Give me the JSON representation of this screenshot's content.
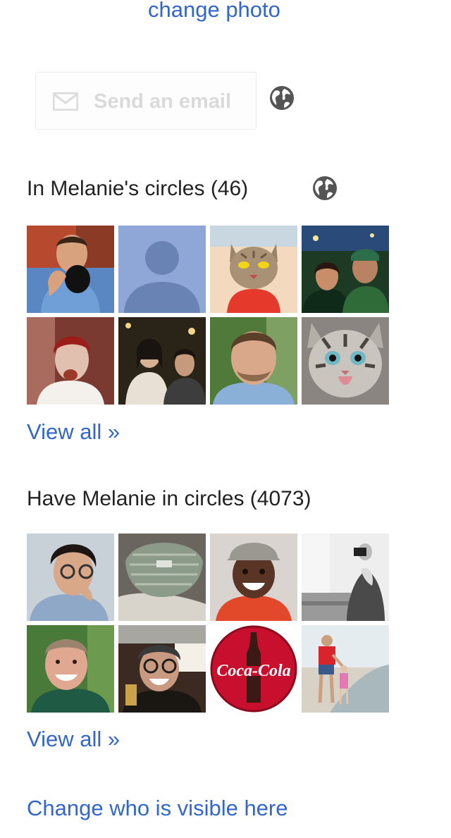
{
  "profile": {
    "change_photo": "change photo"
  },
  "email_button": {
    "label": "Send an email",
    "icon": "envelope-icon"
  },
  "in_circles": {
    "title": "In Melanie's circles (46)",
    "visibility_icon": "globe-icon",
    "view_all": "View all »",
    "people": [
      {
        "name": "person-drinking",
        "kind": "photo"
      },
      {
        "name": "default-silhouette",
        "kind": "placeholder"
      },
      {
        "name": "cartoon-cat",
        "kind": "illustration"
      },
      {
        "name": "couple-at-night",
        "kind": "photo"
      },
      {
        "name": "red-haired-man",
        "kind": "photo"
      },
      {
        "name": "two-friends",
        "kind": "photo"
      },
      {
        "name": "bearded-man",
        "kind": "photo"
      },
      {
        "name": "tabby-kitten",
        "kind": "photo"
      }
    ]
  },
  "have_in_circles": {
    "title": "Have Melanie in circles (4073)",
    "view_all": "View all »",
    "people": [
      {
        "name": "man-with-glasses",
        "kind": "photo"
      },
      {
        "name": "striped-hat",
        "kind": "photo"
      },
      {
        "name": "smiling-man-cap",
        "kind": "photo"
      },
      {
        "name": "photographer-bw",
        "kind": "photo"
      },
      {
        "name": "smiling-older-man",
        "kind": "photo"
      },
      {
        "name": "woman-with-glasses",
        "kind": "photo"
      },
      {
        "name": "coca-cola-logo",
        "kind": "logo"
      },
      {
        "name": "father-child-beach",
        "kind": "photo"
      }
    ]
  },
  "visibility": {
    "change_visible": "Change who is visible here"
  },
  "colors": {
    "link": "#3366cc",
    "heading": "#222222",
    "disabled_button_text": "#dadada",
    "globe": "#555555"
  }
}
